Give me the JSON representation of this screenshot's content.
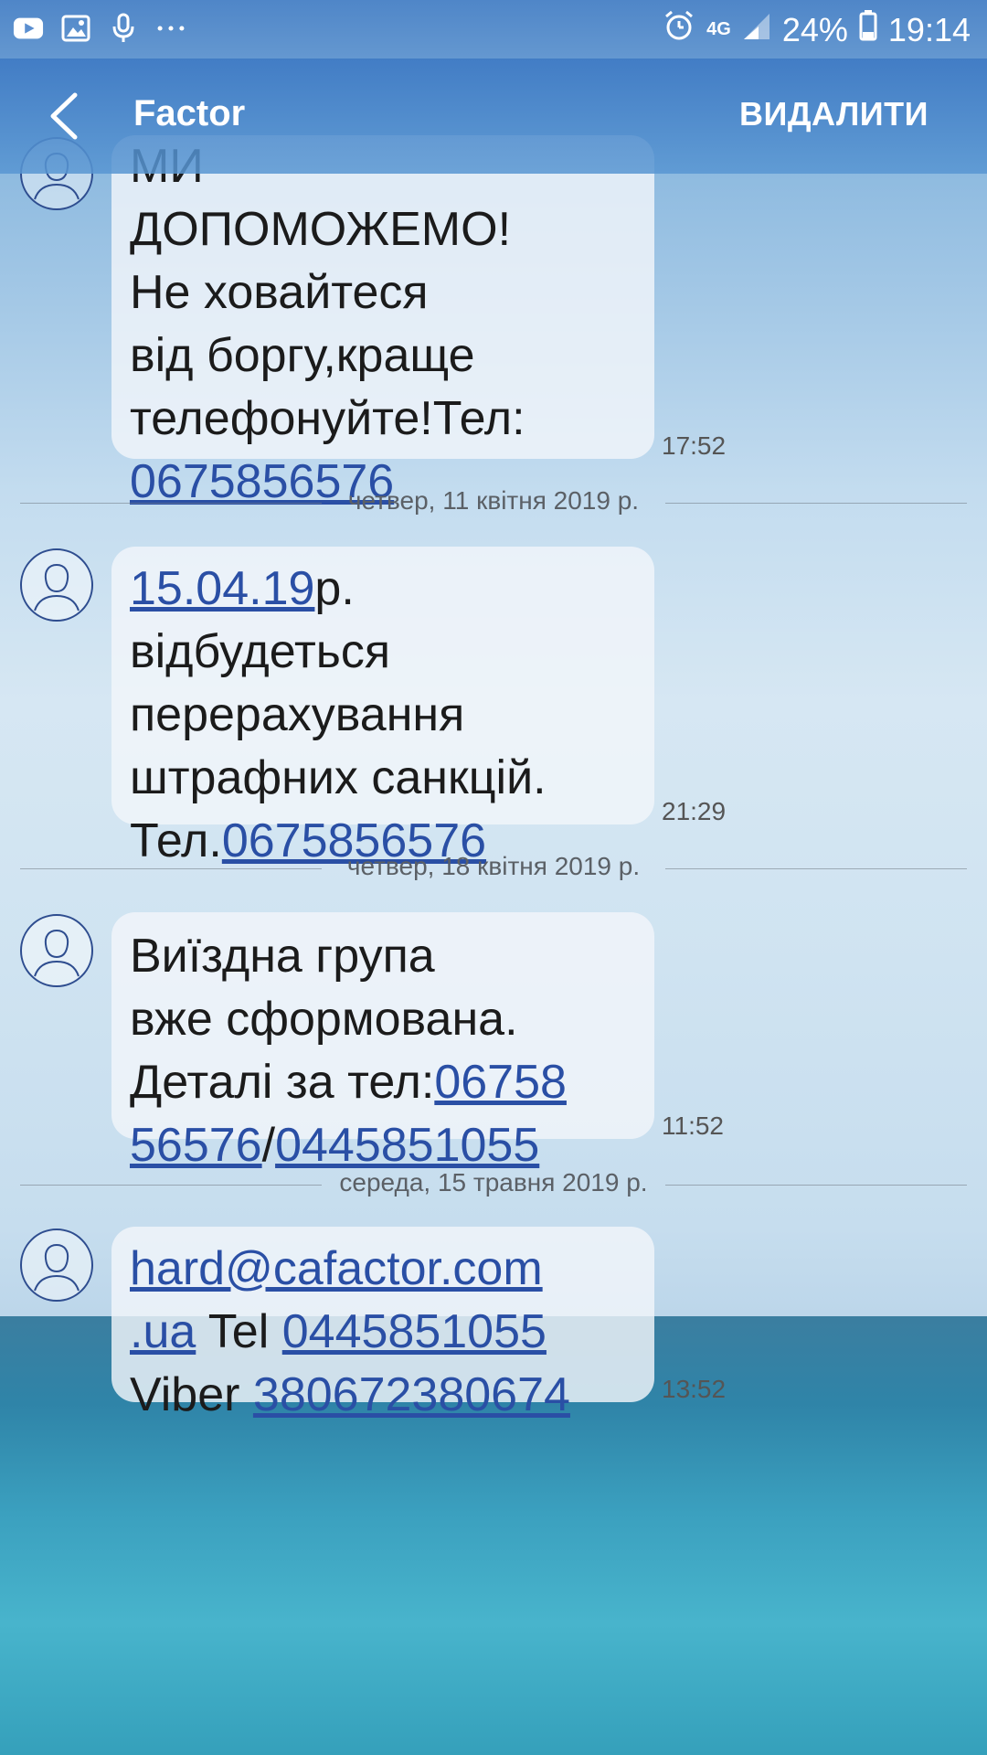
{
  "status_bar": {
    "left_icons": [
      "youtube-icon",
      "gallery-icon",
      "microphone-icon",
      "more-icon"
    ],
    "network": "4G",
    "battery": "24%",
    "time": "19:14"
  },
  "app_bar": {
    "title": "Factor",
    "delete_label": "ВИДАЛИТИ"
  },
  "messages": [
    {
      "lines": [
        [
          {
            "t": "МИ"
          }
        ],
        [
          {
            "t": "ДОПОМОЖЕМО!"
          }
        ],
        [
          {
            "t": "Не ховайтеся"
          }
        ],
        [
          {
            "t": "від боргу,краще"
          }
        ],
        [
          {
            "t": "телефонуйте!Тел:"
          }
        ],
        [
          {
            "t": "0675856576",
            "link": true
          }
        ]
      ],
      "time": "17:52"
    },
    {
      "date": "четвер, 11 квітня 2019 р.",
      "lines": [
        [
          {
            "t": "15.04.19",
            "link": true
          },
          {
            "t": "р."
          }
        ],
        [
          {
            "t": "відбудеться"
          }
        ],
        [
          {
            "t": "перерахування"
          }
        ],
        [
          {
            "t": "штрафних санкцій."
          }
        ],
        [
          {
            "t": "Тел."
          },
          {
            "t": "0675856576",
            "link": true
          }
        ]
      ],
      "time": "21:29"
    },
    {
      "date": "четвер, 18 квітня 2019 р.",
      "lines": [
        [
          {
            "t": "Виїздна група"
          }
        ],
        [
          {
            "t": "вже сформована."
          }
        ],
        [
          {
            "t": "Деталі за тел:"
          },
          {
            "t": "06758",
            "link": true
          }
        ],
        [
          {
            "t": "56576",
            "link": true
          },
          {
            "t": "/"
          },
          {
            "t": "0445851055",
            "link": true
          }
        ]
      ],
      "time": "11:52"
    },
    {
      "date": "середа, 15 травня 2019 р.",
      "lines": [
        [
          {
            "t": "hard@cafactor.com",
            "link": true
          }
        ],
        [
          {
            "t": ".ua",
            "link": true
          },
          {
            "t": " Tel "
          },
          {
            "t": "0445851055",
            "link": true
          }
        ],
        [
          {
            "t": "Viber "
          },
          {
            "t": "380672380674",
            "link": true
          }
        ]
      ],
      "time": "13:52"
    }
  ]
}
